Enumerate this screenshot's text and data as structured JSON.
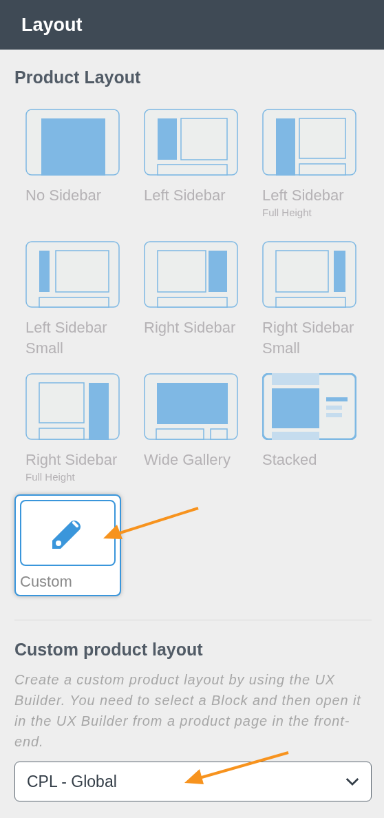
{
  "header": {
    "title": "Layout"
  },
  "product_layout": {
    "heading": "Product Layout",
    "options": [
      {
        "kind": "no-sidebar",
        "label": "No Sidebar",
        "selected": false
      },
      {
        "kind": "left-sidebar",
        "label": "Left Sidebar",
        "selected": false
      },
      {
        "kind": "left-sidebar-full",
        "label": "Left Sidebar",
        "sublabel": "Full Height",
        "selected": false
      },
      {
        "kind": "left-sidebar-small",
        "label": "Left Sidebar Small",
        "selected": false
      },
      {
        "kind": "right-sidebar",
        "label": "Right Sidebar",
        "selected": false
      },
      {
        "kind": "right-sidebar-small",
        "label": "Right Sidebar Small",
        "selected": false
      },
      {
        "kind": "right-sidebar-full",
        "label": "Right Sidebar",
        "sublabel": "Full Height",
        "selected": false
      },
      {
        "kind": "wide-gallery",
        "label": "Wide Gallery",
        "selected": false
      },
      {
        "kind": "stacked",
        "label": "Stacked",
        "selected": false
      },
      {
        "kind": "custom",
        "label": "Custom",
        "selected": true
      }
    ]
  },
  "custom_product_layout": {
    "heading": "Custom product layout",
    "description": "Create a custom product layout by using the UX Builder. You need to select a Block and then open it in the UX Builder from a product page in the front-end.",
    "select": {
      "value": "CPL - Global"
    }
  }
}
